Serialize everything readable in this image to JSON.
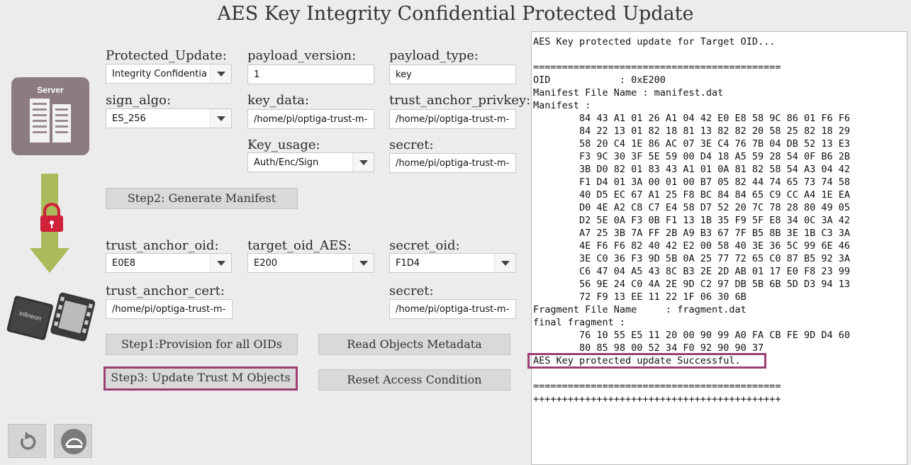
{
  "app": {
    "title": "AES Key Integrity Confidential Protected Update"
  },
  "left_panel": {
    "server_label": "Server",
    "chip_brand": "infineon",
    "icons": [
      "server-icon",
      "arrow-down-icon",
      "lock-icon",
      "chip-icon",
      "reset-icon",
      "exit-icon"
    ],
    "accent_color": "#9b3f73"
  },
  "form": {
    "protected_update": {
      "label": "Protected_Update:",
      "value": "Integrity Confidentia"
    },
    "payload_version": {
      "label": "payload_version:",
      "value": "1"
    },
    "payload_type": {
      "label": "payload_type:",
      "value": "key"
    },
    "sign_algo": {
      "label": "sign_algo:",
      "value": "ES_256"
    },
    "key_data": {
      "label": "key_data:",
      "value": "/home/pi/optiga-trust-m-"
    },
    "trust_anchor_privkey": {
      "label": "trust_anchor_privkey:",
      "value": "/home/pi/optiga-trust-m-"
    },
    "key_usage": {
      "label": "Key_usage:",
      "value": "Auth/Enc/Sign"
    },
    "secret_path": {
      "label": "secret:",
      "value": "/home/pi/optiga-trust-m-"
    },
    "trust_anchor_oid": {
      "label": "trust_anchor_oid:",
      "value": "E0E8"
    },
    "target_oid_aes": {
      "label": "target_oid_AES:",
      "value": "E200"
    },
    "secret_oid": {
      "label": "secret_oid:",
      "value": "F1D4"
    },
    "trust_anchor_cert": {
      "label": "trust_anchor_cert:",
      "value": "/home/pi/optiga-trust-m-"
    },
    "secret_path2": {
      "label": "secret:",
      "value": "/home/pi/optiga-trust-m-"
    }
  },
  "buttons": {
    "step2": "Step2: Generate Manifest",
    "step1": "Step1:Provision for all OIDs",
    "read_metadata": "Read Objects Metadata",
    "step3": "Step3: Update Trust M Objects",
    "reset_access": "Reset Access Condition"
  },
  "console": {
    "text": "AES Key protected update for Target OID...\n\n===========================================\nOID            : 0xE200\nManifest File Name : manifest.dat\nManifest :\n        84 43 A1 01 26 A1 04 42 E0 E8 58 9C 86 01 F6 F6\n        84 22 13 01 82 18 81 13 82 82 20 58 25 82 18 29\n        58 20 C4 1E 86 AC 07 3E C4 76 7B 04 DB 52 13 E3\n        F3 9C 30 3F 5E 59 00 D4 18 A5 59 28 54 0F B6 2B\n        3B D0 82 01 83 43 A1 01 0A 81 82 58 54 A3 04 42\n        F1 D4 01 3A 00 01 00 B7 05 82 44 74 65 73 74 58\n        40 D5 EC 67 A1 25 F8 BC 84 84 65 C9 CC A4 1E EA\n        D0 4E A2 C8 C7 E4 58 D7 52 20 7C 78 28 80 49 05\n        D2 5E 0A F3 0B F1 13 1B 35 F9 5F E8 34 0C 3A 42\n        A7 25 3B 7A FF 2B A9 B3 67 7F B5 8B 3E 1B C3 3A\n        4E F6 F6 82 40 42 E2 00 58 40 3E 36 5C 99 6E 46\n        3E C0 36 F3 9D 5B 0A 25 77 72 65 C0 87 B5 92 3A\n        C6 47 04 A5 43 8C B3 2E 2D AB 01 17 E0 F8 23 99\n        56 9E 24 C0 4A 2E 9D C2 97 DB 5B 6B 5D D3 94 13\n        72 F9 13 EE 11 22 1F 06 30 6B\nFragment File Name     : fragment.dat\nfinal fragment :\n        76 10 55 E5 11 20 00 90 99 A0 FA CB FE 9D D4 60\n        80 85 98 00 52 34 F0 92 90 90 37\nAES Key protected update Successful.\n\n===========================================\n+++++++++++++++++++++++++++++++++++++++++++"
  }
}
